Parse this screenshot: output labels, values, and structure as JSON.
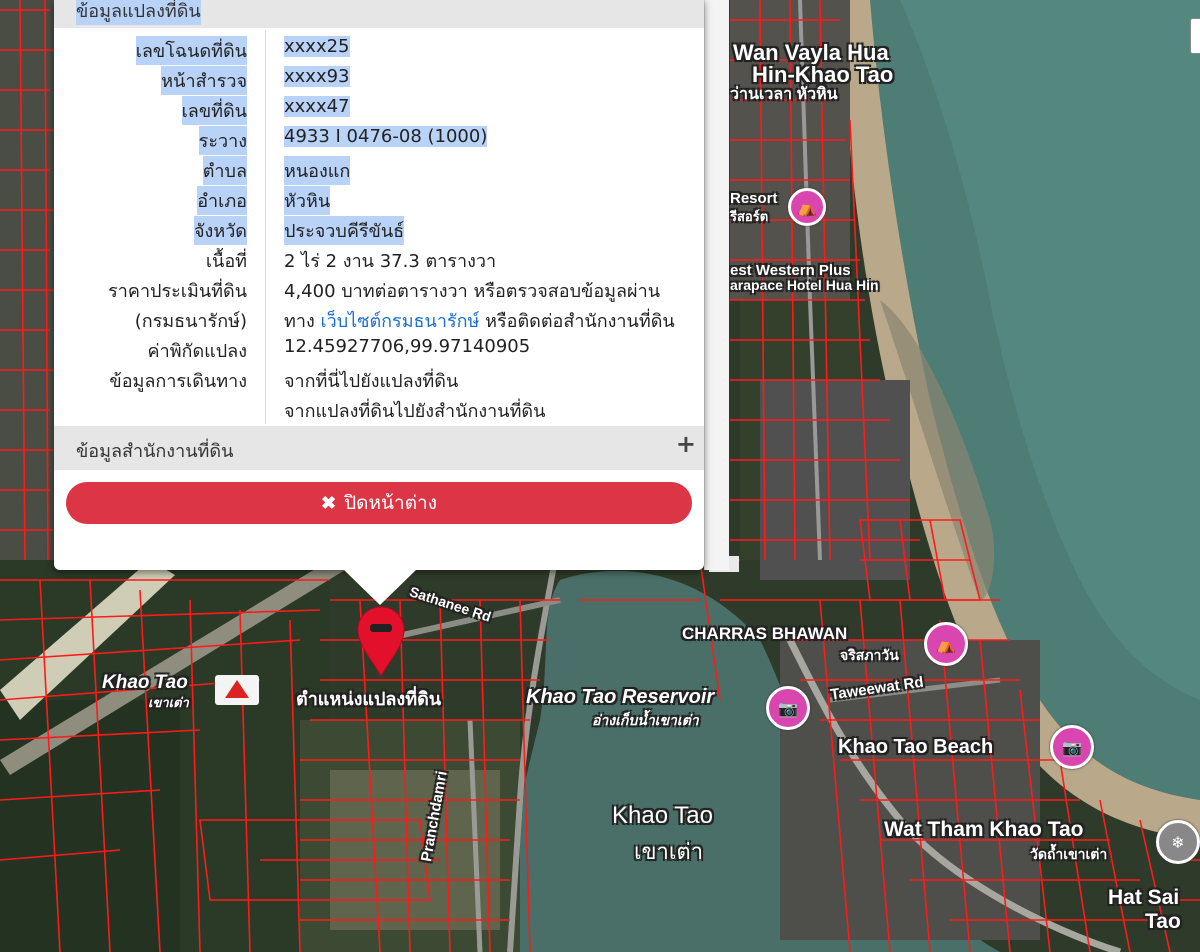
{
  "popup": {
    "parcel_section_title": "ข้อมูลแปลงที่ดิน",
    "rows": [
      {
        "label": "เลขโฉนดที่ดิน",
        "value": "xxxx25"
      },
      {
        "label": "หน้าสำรวจ",
        "value": "xxxx93"
      },
      {
        "label": "เลขที่ดิน",
        "value": "xxxx47"
      },
      {
        "label": "ระวาง",
        "value": "4933 I 0476-08 (1000)"
      },
      {
        "label": "ตำบล",
        "value": "หนองแก"
      },
      {
        "label": "อำเภอ",
        "value": "หัวหิน"
      },
      {
        "label": "จังหวัด",
        "value": "ประจวบคีรีขันธ์"
      },
      {
        "label": "เนื้อที่",
        "value": "2 ไร่ 2 งาน 37.3 ตารางวา"
      }
    ],
    "price": {
      "label_line1": "ราคาประเมินที่ดิน",
      "label_line2": "(กรมธนารักษ์)",
      "value_line1": "4,400 บาทต่อตารางวา หรือตรวจสอบข้อมูลผ่าน",
      "value_line2_prefix": "ทาง ",
      "value_link": "เว็บไซต์กรมธนารักษ์",
      "value_line2_suffix": " หรือติดต่อสำนักงานที่ดิน"
    },
    "coords": {
      "label": "ค่าพิกัดแปลง",
      "value": "12.45927706,99.97140905"
    },
    "travel": {
      "label": "ข้อมูลการเดินทาง",
      "link1": "จากที่นี่ไปยังแปลงที่ดิน",
      "link2": "จากแปลงที่ดินไปยังสำนักงานที่ดิน"
    },
    "office_section_title": "ข้อมูลสำนักงานที่ดิน",
    "expand_glyph": "+",
    "close_label": "ปิดหน้าต่าง",
    "close_glyph": "✖"
  },
  "map": {
    "marker_label": "ตำแหน่งแปลงที่ดิน",
    "labels": {
      "wan_vayla_1": "Wan Vayla Hua",
      "wan_vayla_2": "Hin-Khao Tao",
      "wan_vayla_th": "ว่านเวลา หัวหิน",
      "resort": "Resort",
      "resort_th": "รีสอร์ต",
      "best_western_1": "est Western Plus",
      "best_western_2": "arapace Hotel Hua Hin",
      "charras": "CHARRAS BHAWAN",
      "charras_th": "จริสภาวัน",
      "taweewat": "Taweewat Rd",
      "reservoir": "Khao Tao Reservoir",
      "reservoir_th": "อ่างเก็บน้ำเขาเต่า",
      "beach": "Khao Tao Beach",
      "khao_tao": "Khao Tao",
      "khao_tao_th": "เขาเต่า",
      "khao_tao_station": "Khao Tao",
      "khao_tao_station_th": "เขาเต่า",
      "wat_tham": "Wat Tham Khao Tao",
      "wat_tham_th": "วัดถ้ำเขาเต่า",
      "hat_sai_1": "Hat Sai",
      "hat_sai_2": "Tao",
      "sathanee": "Sathanee Rd",
      "pranchdamri": "Pranchdamri"
    },
    "colors": {
      "parcel_line": "#ff1a1a",
      "marker": "#e3102b",
      "sea": "#4e7d76",
      "poi": "#d946b0"
    }
  }
}
